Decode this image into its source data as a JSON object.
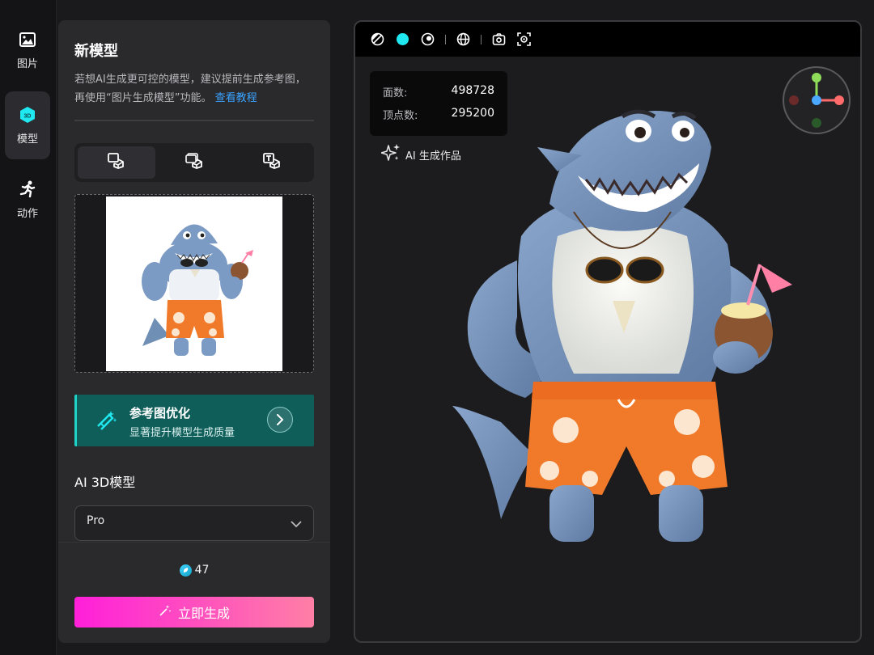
{
  "nav": {
    "items": [
      {
        "label": "图片",
        "icon": "image-icon"
      },
      {
        "label": "模型",
        "icon": "3d-cube-icon",
        "active": true
      },
      {
        "label": "动作",
        "icon": "running-person-icon"
      }
    ]
  },
  "panel": {
    "title": "新模型",
    "desc": "若想AI生成更可控的模型，建议提前生成参考图，再使用“图片生成模型”功能。",
    "desc_link": "查看教程",
    "modes": [
      {
        "icon": "image-to-3d-icon",
        "active": true
      },
      {
        "icon": "multi-image-to-3d-icon"
      },
      {
        "icon": "text-to-3d-icon"
      }
    ],
    "optimize": {
      "title": "参考图优化",
      "subtitle": "显著提升模型生成质量"
    },
    "model_label": "AI 3D模型",
    "model_select": "Pro",
    "credits": "47",
    "generate_label": "立即生成"
  },
  "viewport": {
    "toolbar_icons": [
      "wireframe-icon",
      "solid-color-icon",
      "matcap-icon",
      "globe-icon",
      "screenshot-icon",
      "focus-icon"
    ],
    "stats": {
      "faces_label": "面数:",
      "faces_value": "498728",
      "vertices_label": "顶点数:",
      "vertices_value": "295200"
    },
    "ai_tag": "AI 生成作品"
  },
  "colors": {
    "accent_cyan": "#1fe8f0",
    "optimize_bg": "#0f5e5a",
    "generate_start": "#ff1fd9",
    "generate_end": "#ff7fa5",
    "link": "#3aa3ff"
  }
}
